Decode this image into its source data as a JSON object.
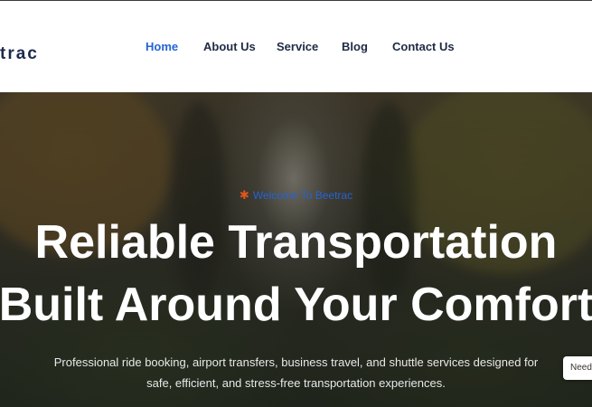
{
  "header": {
    "logo_text": "trac",
    "nav": [
      {
        "label": "Home",
        "active": true
      },
      {
        "label": "About Us",
        "active": false
      },
      {
        "label": "Service",
        "active": false
      },
      {
        "label": "Blog",
        "active": false
      },
      {
        "label": "Contact Us",
        "active": false
      }
    ]
  },
  "hero": {
    "tag_icon": "asterisk-icon",
    "tag_text": "Welcome To Beetrac",
    "headline_line1": "Reliable Transportation",
    "headline_line2": "Built Around Your Comfort",
    "description_line1": "Professional ride booking, airport transfers, business travel, and shuttle services designed for",
    "description_line2": "safe, efficient, and stress-free transportation experiences."
  },
  "floating": {
    "need_button_label": "Need"
  },
  "colors": {
    "accent": "#2563d6",
    "nav_text": "#1f2a44",
    "star": "#e0561c"
  }
}
